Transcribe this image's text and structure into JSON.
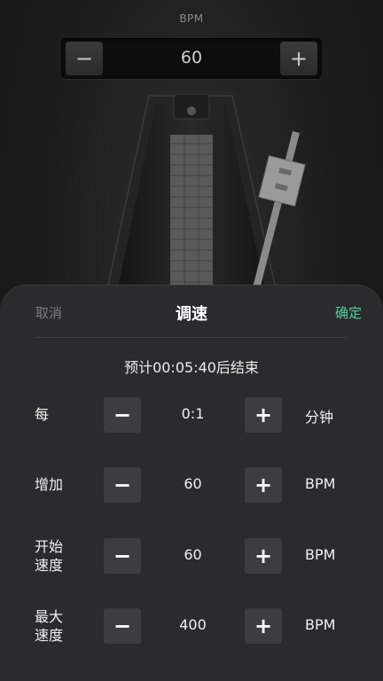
{
  "header": {
    "bpm_label": "BPM",
    "bpm_value": "60",
    "minus": "−",
    "plus": "+"
  },
  "sheet": {
    "cancel": "取消",
    "title": "调速",
    "confirm": "确定",
    "estimate": "预计00:05:40后结束",
    "rows": [
      {
        "label": "每",
        "value": "0:1",
        "unit": "分钟"
      },
      {
        "label": "增加",
        "value": "60",
        "unit": "BPM"
      },
      {
        "label_line1": "开始",
        "label_line2": "速度",
        "value": "60",
        "unit": "BPM"
      },
      {
        "label_line1": "最大",
        "label_line2": "速度",
        "value": "400",
        "unit": "BPM"
      }
    ],
    "minus": "−",
    "plus": "+"
  },
  "colors": {
    "accent": "#4fd19a",
    "sheet_bg": "#2b2b2d",
    "button_bg": "#3d3d3f"
  }
}
